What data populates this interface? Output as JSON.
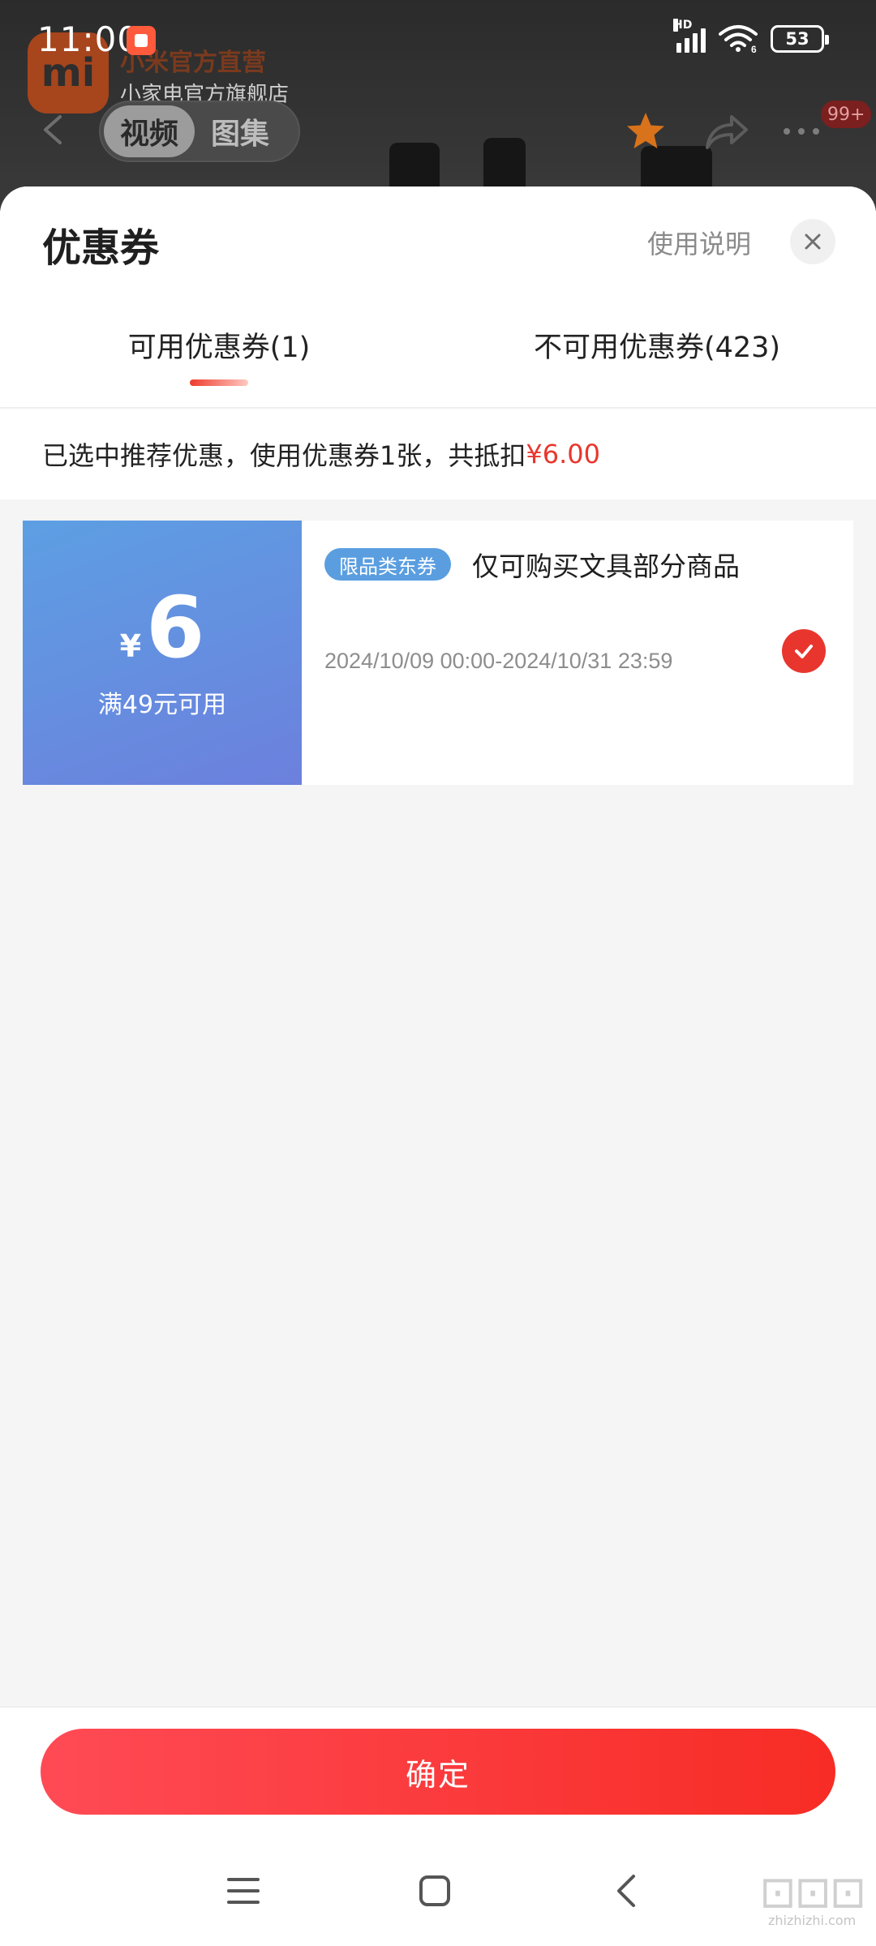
{
  "status_bar": {
    "time": "11:00",
    "network": "HD",
    "wifi_gen": "6",
    "battery": "53"
  },
  "background_page": {
    "shop_logo_text": "mi",
    "shop_name": "小米官方直营",
    "shop_subtitle": "小家电官方旗舰店",
    "media_tabs": [
      {
        "label": "视频",
        "active": true
      },
      {
        "label": "图集",
        "active": false
      }
    ],
    "message_badge": "99+",
    "star_color": "#d8731b"
  },
  "sheet": {
    "title": "优惠券",
    "help_link": "使用说明",
    "tabs": [
      {
        "label": "可用优惠券(1)",
        "active": true
      },
      {
        "label": "不可用优惠券(423)",
        "active": false
      }
    ],
    "summary_prefix": "已选中推荐优惠，使用优惠券1张，共抵扣",
    "summary_amount": "¥6.00",
    "coupons": [
      {
        "currency": "¥",
        "value": "6",
        "condition": "满49元可用",
        "tag": "限品类东券",
        "description": "仅可购买文具部分商品",
        "validity": "2024/10/09 00:00-2024/10/31 23:59",
        "selected": true
      }
    ],
    "confirm_label": "确定"
  },
  "colors": {
    "accent_red": "#e8362e",
    "coupon_blue": "#5d9fe3",
    "tag_blue": "#5a9ee0"
  },
  "nav_bar": {
    "icons": [
      "menu-icon",
      "home-square-icon",
      "back-chevron-icon"
    ]
  },
  "watermark": {
    "text": "zhizhizhi.com"
  }
}
